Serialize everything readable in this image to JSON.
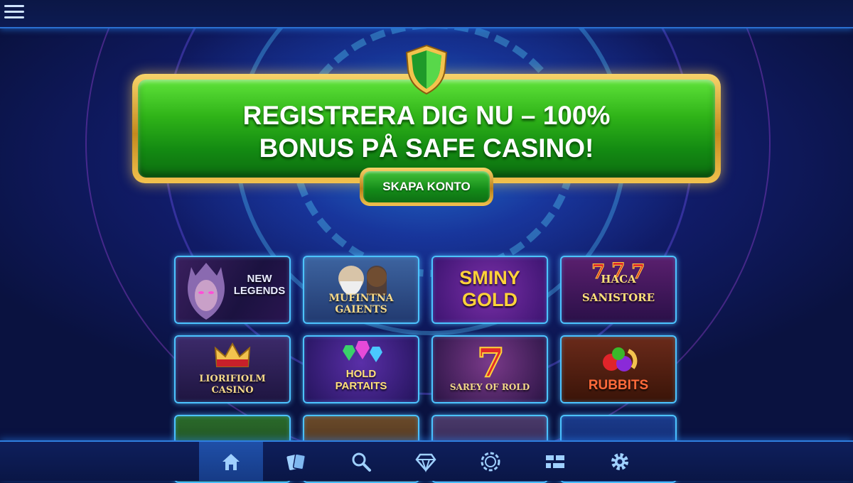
{
  "banner": {
    "title": "REGISTRERA DIG NU – 100%\nBONUS PÅ SAFE CASINO!",
    "cta_label": "SKAPA KONTO",
    "icon": "shield-icon"
  },
  "games": [
    {
      "title": "NEW\nLEGENDS"
    },
    {
      "title": "MUFINTNA\nGAIENTS"
    },
    {
      "title": "SMINY\nGOLD"
    },
    {
      "title": "HACA\nSANISTORE"
    },
    {
      "title": "LIORIFIOLM\nCASINO"
    },
    {
      "title": "HOLD\nPARTAITS"
    },
    {
      "title": "SAREY OF ROLD"
    },
    {
      "title": "RUBBITS"
    }
  ],
  "nav": {
    "items": [
      {
        "icon": "home-icon",
        "active": true
      },
      {
        "icon": "cards-icon",
        "active": false
      },
      {
        "icon": "search-icon",
        "active": false
      },
      {
        "icon": "diamond-icon",
        "active": false
      },
      {
        "icon": "chip-icon",
        "active": false
      },
      {
        "icon": "grid-icon",
        "active": false
      },
      {
        "icon": "gear-icon",
        "active": false
      }
    ]
  },
  "colors": {
    "accent": "#4cc3ff",
    "banner_green": "#2fb318",
    "banner_gold": "#f2c24e",
    "background": "#0a1240"
  }
}
